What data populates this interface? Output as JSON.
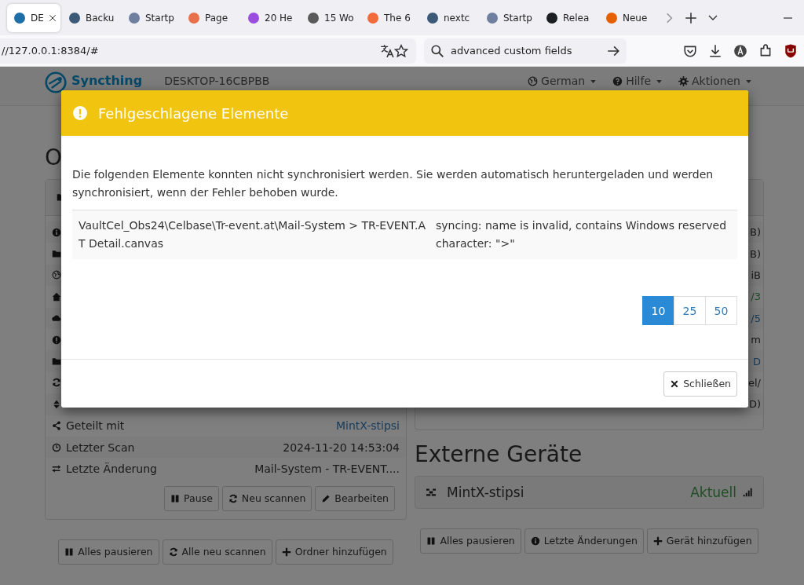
{
  "browser": {
    "tabs": [
      {
        "label": "DE",
        "selected": true,
        "color": "#1e6fa8"
      },
      {
        "label": "Backu",
        "selected": false,
        "color": "#3c5a78"
      },
      {
        "label": "Startp",
        "selected": false,
        "color": "#6f7fa0"
      },
      {
        "label": "Page",
        "selected": false,
        "color": "#e8704a"
      },
      {
        "label": "20 He",
        "selected": false,
        "color": "#9b4de0"
      },
      {
        "label": "15 Wo",
        "selected": false,
        "color": "#5a5a5a"
      },
      {
        "label": "The 6",
        "selected": false,
        "color": "#f26b3a"
      },
      {
        "label": "nextc",
        "selected": false,
        "color": "#3c5a78"
      },
      {
        "label": "Startp",
        "selected": false,
        "color": "#6f7fa0"
      },
      {
        "label": "Relea",
        "selected": false,
        "color": "#1b1f23"
      },
      {
        "label": "Neue",
        "selected": false,
        "color": "#e66000"
      }
    ],
    "url": "//127.0.0.1:8384/#",
    "search": "advanced custom fields"
  },
  "navbar": {
    "brand": "Syncthing",
    "device": "DESKTOP-16CBPBB",
    "menus": [
      {
        "label": "German",
        "kind": "globe"
      },
      {
        "label": "Hilfe",
        "kind": "help"
      },
      {
        "label": "Aktionen",
        "kind": "gear"
      }
    ]
  },
  "folders": {
    "heading": "O",
    "rows": [
      {
        "label": "Geteilt mit",
        "value": "MintX-stipsi",
        "kind": "share",
        "link": true
      },
      {
        "label": "Letzter Scan",
        "value": "2024-11-20 14:53:04",
        "kind": "clock",
        "link": false
      },
      {
        "label": "Letzte Änderung",
        "value": "Mail-System - TR-EVENT....",
        "kind": "exchange",
        "link": false
      }
    ],
    "buttons": [
      {
        "label": "Pause",
        "kind": "pause"
      },
      {
        "label": "Neu scannen",
        "kind": "refresh"
      },
      {
        "label": "Bearbeiten",
        "kind": "pencil"
      }
    ],
    "actions": [
      {
        "label": "Alles pausieren",
        "kind": "pause"
      },
      {
        "label": "Alle neu scannen",
        "kind": "refresh"
      },
      {
        "label": "Ordner hinzufügen",
        "kind": "plus"
      }
    ]
  },
  "this_device": {
    "rows": [
      {
        "value": "B)",
        "kind": "plain"
      },
      {
        "value": "B)",
        "kind": "plain"
      },
      {
        "value": "iB",
        "kind": "plain"
      },
      {
        "value": "/3",
        "kind": "ok"
      },
      {
        "value": "/5",
        "kind": "link"
      },
      {
        "value": "m",
        "kind": "plain"
      },
      {
        "value": "D",
        "kind": "link"
      },
      {
        "value": "el/",
        "kind": "plain"
      },
      {
        "value": "D)",
        "kind": "plain"
      }
    ]
  },
  "remote_devices": {
    "heading": "Externe Geräte",
    "devices": [
      {
        "name": "MintX-stipsi",
        "status": "Aktuell"
      }
    ],
    "buttons": [
      {
        "label": "Alles pausieren",
        "kind": "pause"
      },
      {
        "label": "Letzte Änderungen",
        "kind": "info"
      },
      {
        "label": "Gerät hinzufügen",
        "kind": "plus"
      }
    ]
  },
  "modal": {
    "title": "Fehlgeschlagene Elemente",
    "message": "Die folgenden Elemente konnten nicht synchronisiert werden. Sie werden automatisch heruntergeladen und werden synchronisiert, wenn der Fehler behoben wurde.",
    "errors": [
      {
        "path": "VaultCel_Obs24\\Celbase\\Tr-event.at\\Mail-System > TR-EVENT.AT Detail.canvas",
        "error": "syncing: name is invalid, contains Windows reserved character: \">\""
      }
    ],
    "page_sizes": [
      {
        "label": "10",
        "selected": true
      },
      {
        "label": "25",
        "selected": false
      },
      {
        "label": "50",
        "selected": false
      }
    ],
    "close": "Schließen"
  }
}
